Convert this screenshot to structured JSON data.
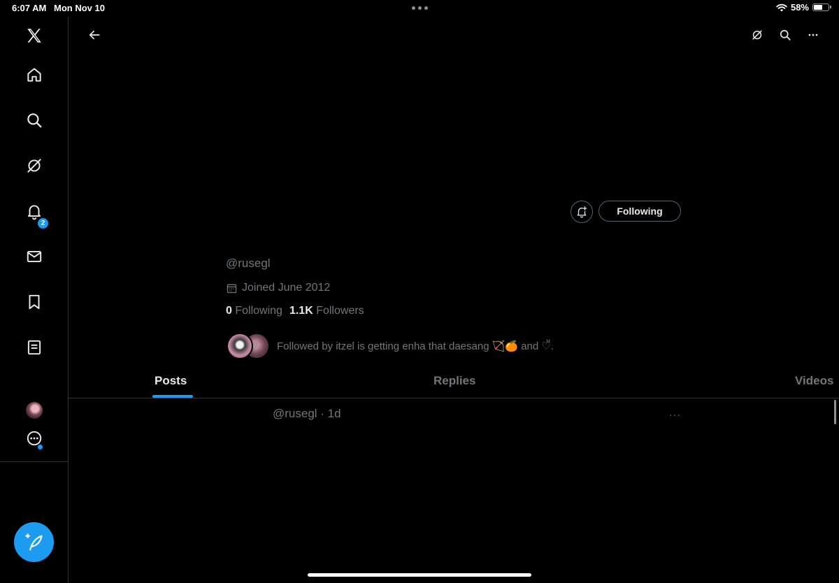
{
  "status_bar": {
    "time": "6:07 AM",
    "date": "Mon Nov 10",
    "battery": "58%"
  },
  "sidebar": {
    "notifications_badge": "2",
    "items": [
      "x-logo",
      "home",
      "explore",
      "grok",
      "notifications",
      "messages",
      "bookmarks",
      "lists",
      "profile",
      "more"
    ]
  },
  "profile": {
    "handle": "@rusegl",
    "joined": "Joined June 2012",
    "following_count": "0",
    "following_label": "Following",
    "followers_count": "1.1K",
    "followers_label": "Followers",
    "followed_by": "Followed by itzel is getting enha that daesang 🏹🍊 and ♡̆̈."
  },
  "follow_button": {
    "label": "Following"
  },
  "tabs": [
    {
      "label": "Posts",
      "active": true
    },
    {
      "label": "Replies",
      "active": false
    },
    {
      "label": "Videos",
      "active": false
    }
  ],
  "post": {
    "handle_time": "@rusegl · 1d",
    "more": "···"
  },
  "colors": {
    "accent": "#1d9bf0",
    "background": "#000000",
    "muted": "#71767b"
  }
}
